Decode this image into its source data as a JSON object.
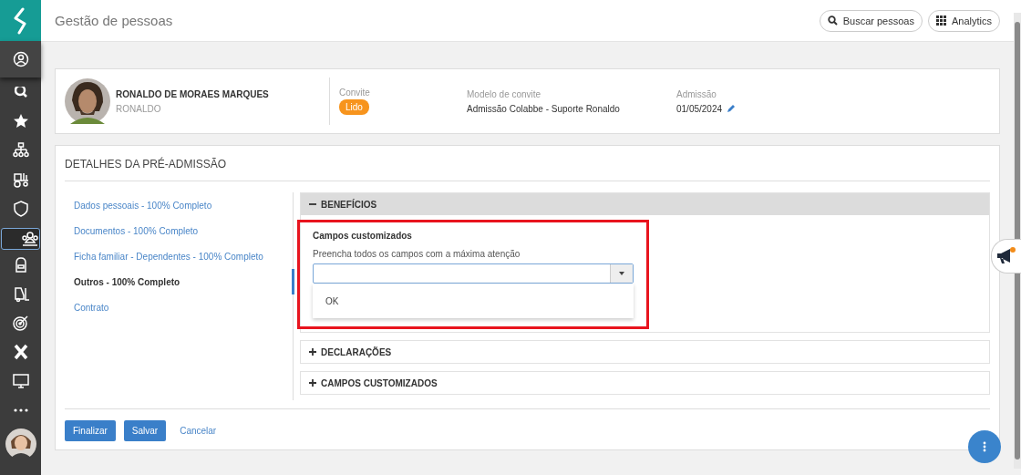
{
  "sidebar": {
    "items": [
      {
        "kind": "profile",
        "selected": false
      },
      {
        "kind": "search",
        "selected": false
      },
      {
        "kind": "star",
        "selected": false
      },
      {
        "kind": "org",
        "selected": false
      },
      {
        "kind": "tractor",
        "selected": false
      },
      {
        "kind": "shield",
        "selected": false
      },
      {
        "kind": "team",
        "selected": true
      },
      {
        "kind": "backpack",
        "selected": false
      },
      {
        "kind": "forklift",
        "selected": false
      },
      {
        "kind": "target",
        "selected": false
      },
      {
        "kind": "x",
        "selected": false
      },
      {
        "kind": "monitor",
        "selected": false
      },
      {
        "kind": "more",
        "selected": false
      }
    ]
  },
  "header": {
    "title": "Gestão de pessoas",
    "actions": [
      {
        "kind": "search",
        "label": "Buscar pessoas"
      },
      {
        "kind": "grid",
        "label": "Analytics"
      }
    ]
  },
  "person": {
    "name": "RONALDO DE MORAES MARQUES",
    "nickname": "RONALDO",
    "fields": [
      {
        "label": "Convite",
        "kind": "badge",
        "value": "Lido"
      },
      {
        "label": "Modelo de convite",
        "kind": "text",
        "value": "Admissão Colabbe - Suporte Ronaldo"
      },
      {
        "label": "Admissão",
        "kind": "editable",
        "value": "01/05/2024"
      }
    ]
  },
  "details": {
    "title": "DETALHES DA PRÉ-ADMISSÃO",
    "steps": [
      {
        "label": "Dados pessoais - 100% Completo",
        "selected": false
      },
      {
        "label": "Documentos - 100% Completo",
        "selected": false
      },
      {
        "label": "Ficha familiar - Dependentes - 100% Completo",
        "selected": false
      },
      {
        "label": "Outros - 100% Completo",
        "selected": true
      },
      {
        "label": "Contrato",
        "selected": false
      }
    ],
    "sections": [
      {
        "title": "BENEFÍCIOS",
        "expanded": true,
        "highlighted": true,
        "heading": "Campos customizados",
        "prompt": "Preencha todos os campos com a máxima atenção",
        "options": [
          "OK"
        ]
      },
      {
        "title": "DECLARAÇÕES",
        "expanded": false
      },
      {
        "title": "CAMPOS CUSTOMIZADOS",
        "expanded": false
      }
    ],
    "buttons": [
      {
        "kind": "primary",
        "label": "Finalizar"
      },
      {
        "kind": "primary",
        "label": "Salvar"
      },
      {
        "kind": "link",
        "label": "Cancelar"
      }
    ]
  }
}
